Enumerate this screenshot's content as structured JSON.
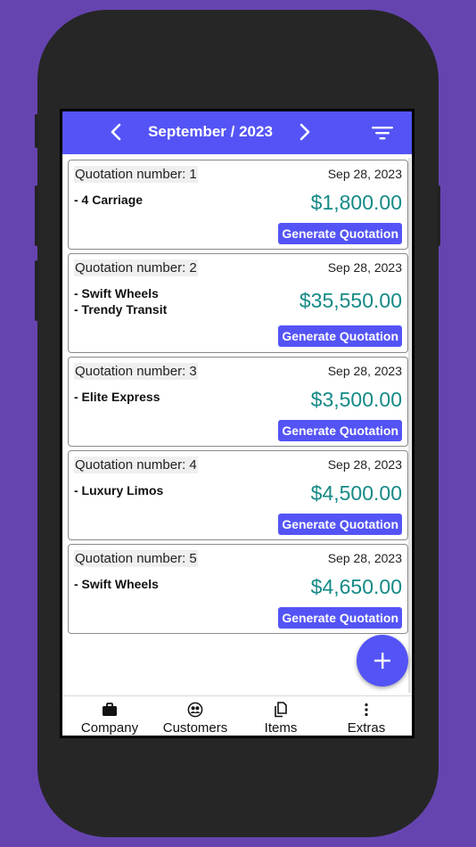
{
  "header": {
    "title": "September / 2023",
    "prev_icon": "chevron-left-icon",
    "next_icon": "chevron-right-icon",
    "filter_icon": "filter-icon"
  },
  "quotations": [
    {
      "label": "Quotation number: 1",
      "date": "Sep 28, 2023",
      "items": [
        "- 4 Carriage"
      ],
      "amount": "$1,800.00",
      "button": "Generate Quotation"
    },
    {
      "label": "Quotation number: 2",
      "date": "Sep 28, 2023",
      "items": [
        "- Swift Wheels",
        "- Trendy Transit"
      ],
      "amount": "$35,550.00",
      "button": "Generate Quotation"
    },
    {
      "label": "Quotation number: 3",
      "date": "Sep 28, 2023",
      "items": [
        "- Elite Express"
      ],
      "amount": "$3,500.00",
      "button": "Generate Quotation"
    },
    {
      "label": "Quotation number: 4",
      "date": "Sep 28, 2023",
      "items": [
        "- Luxury Limos"
      ],
      "amount": "$4,500.00",
      "button": "Generate Quotation"
    },
    {
      "label": "Quotation number: 5",
      "date": "Sep 28, 2023",
      "items": [
        "- Swift Wheels"
      ],
      "amount": "$4,650.00",
      "button": "Generate Quotation"
    }
  ],
  "fab": {
    "icon": "plus-icon"
  },
  "nav": [
    {
      "label": "Company",
      "icon": "briefcase-icon"
    },
    {
      "label": "Customers",
      "icon": "users-icon"
    },
    {
      "label": "Items",
      "icon": "documents-icon"
    },
    {
      "label": "Extras",
      "icon": "more-vertical-icon"
    }
  ],
  "colors": {
    "primary": "#5454f6",
    "amount": "#148a86",
    "background": "#6644b0",
    "phone_body": "#262626"
  }
}
